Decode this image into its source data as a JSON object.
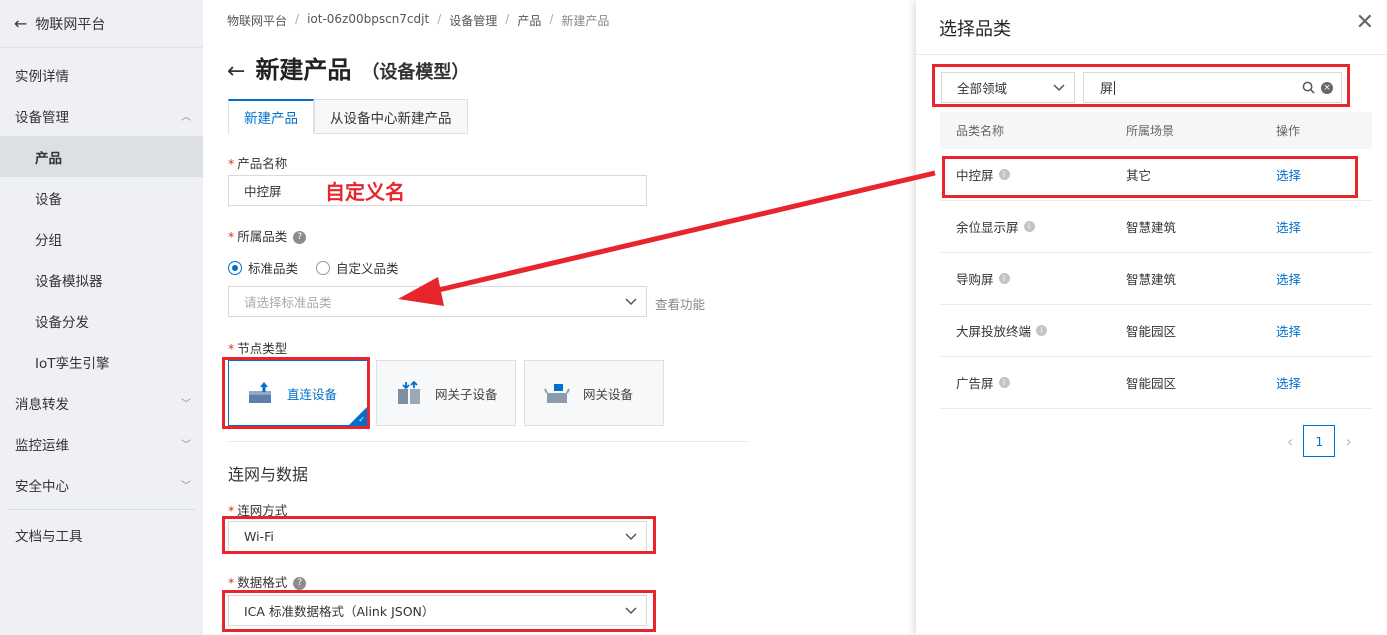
{
  "sidebar": {
    "header": "物联网平台",
    "items": [
      {
        "label": "实例详情"
      },
      {
        "label": "设备管理",
        "chevron": "up"
      },
      {
        "label": "产品",
        "sub": true,
        "active": true
      },
      {
        "label": "设备",
        "sub": true
      },
      {
        "label": "分组",
        "sub": true
      },
      {
        "label": "设备模拟器",
        "sub": true
      },
      {
        "label": "设备分发",
        "sub": true
      },
      {
        "label": "IoT孪生引擎",
        "sub": true
      },
      {
        "label": "消息转发",
        "chevron": "down"
      },
      {
        "label": "监控运维",
        "chevron": "down"
      },
      {
        "label": "安全中心",
        "chevron": "down"
      },
      {
        "label": "文档与工具"
      }
    ]
  },
  "breadcrumb": [
    "物联网平台",
    "iot-06z00bpscn7cdjt",
    "设备管理",
    "产品",
    "新建产品"
  ],
  "page": {
    "title": "新建产品",
    "subtitle": "（设备模型）",
    "tabs": [
      "新建产品",
      "从设备中心新建产品"
    ]
  },
  "form": {
    "product_name_label": "产品名称",
    "product_name_value": "中控屏",
    "annotation": "自定义名",
    "category_label": "所属品类",
    "radio_standard": "标准品类",
    "radio_custom": "自定义品类",
    "category_placeholder": "请选择标准品类",
    "view_function": "查看功能",
    "node_type_label": "节点类型",
    "node_types": [
      "直连设备",
      "网关子设备",
      "网关设备"
    ],
    "section_network": "连网与数据",
    "network_label": "连网方式",
    "network_value": "Wi-Fi",
    "data_format_label": "数据格式",
    "data_format_value": "ICA 标准数据格式（Alink JSON）"
  },
  "drawer": {
    "title": "选择品类",
    "domain_select": "全部领域",
    "search_value": "屏",
    "columns": [
      "品类名称",
      "所属场景",
      "操作"
    ],
    "rows": [
      {
        "name": "中控屏",
        "scene": "其它",
        "action": "选择"
      },
      {
        "name": "余位显示屏",
        "scene": "智慧建筑",
        "action": "选择"
      },
      {
        "name": "导购屏",
        "scene": "智慧建筑",
        "action": "选择"
      },
      {
        "name": "大屏投放终端",
        "scene": "智能园区",
        "action": "选择"
      },
      {
        "name": "广告屏",
        "scene": "智能园区",
        "action": "选择"
      }
    ],
    "page": "1"
  },
  "colors": {
    "accent": "#0070cc",
    "annotation_red": "#e8242c"
  }
}
